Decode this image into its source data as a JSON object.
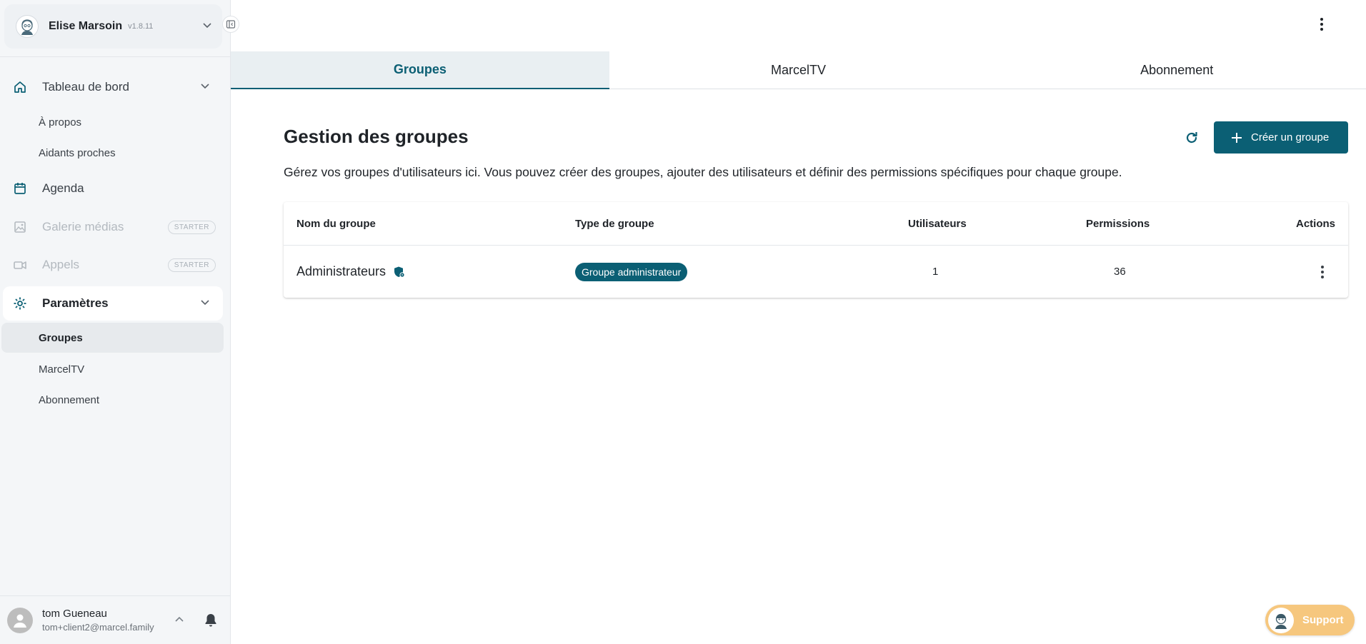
{
  "sidebar": {
    "profile": {
      "name": "Elise Marsoin",
      "version": "v1.8.11"
    },
    "nav": {
      "dashboard": "Tableau de bord",
      "about": "À propos",
      "caregivers": "Aidants proches",
      "agenda": "Agenda",
      "gallery": "Galerie médias",
      "gallery_badge": "STARTER",
      "calls": "Appels",
      "calls_badge": "STARTER",
      "settings": "Paramètres",
      "groups": "Groupes",
      "marceltv": "MarcelTV",
      "subscription": "Abonnement"
    },
    "user": {
      "name": "tom Gueneau",
      "email": "tom+client2@marcel.family"
    }
  },
  "tabs": [
    {
      "label": "Groupes",
      "active": true
    },
    {
      "label": "MarcelTV",
      "active": false
    },
    {
      "label": "Abonnement",
      "active": false
    }
  ],
  "main": {
    "title": "Gestion des groupes",
    "description": "Gérez vos groupes d'utilisateurs ici. Vous pouvez créer des groupes, ajouter des utilisateurs et définir des permissions spécifiques pour chaque groupe.",
    "create_button": "Créer un groupe",
    "table": {
      "headers": {
        "name": "Nom du groupe",
        "type": "Type de groupe",
        "users": "Utilisateurs",
        "permissions": "Permissions",
        "actions": "Actions"
      },
      "rows": [
        {
          "name": "Administrateurs",
          "type": "Groupe administrateur",
          "users": "1",
          "permissions": "36"
        }
      ]
    }
  },
  "support": {
    "label": "Support"
  },
  "colors": {
    "accent": "#0b5f74",
    "support": "#f6c77e",
    "sidebar_bg": "#f4f6f8"
  }
}
